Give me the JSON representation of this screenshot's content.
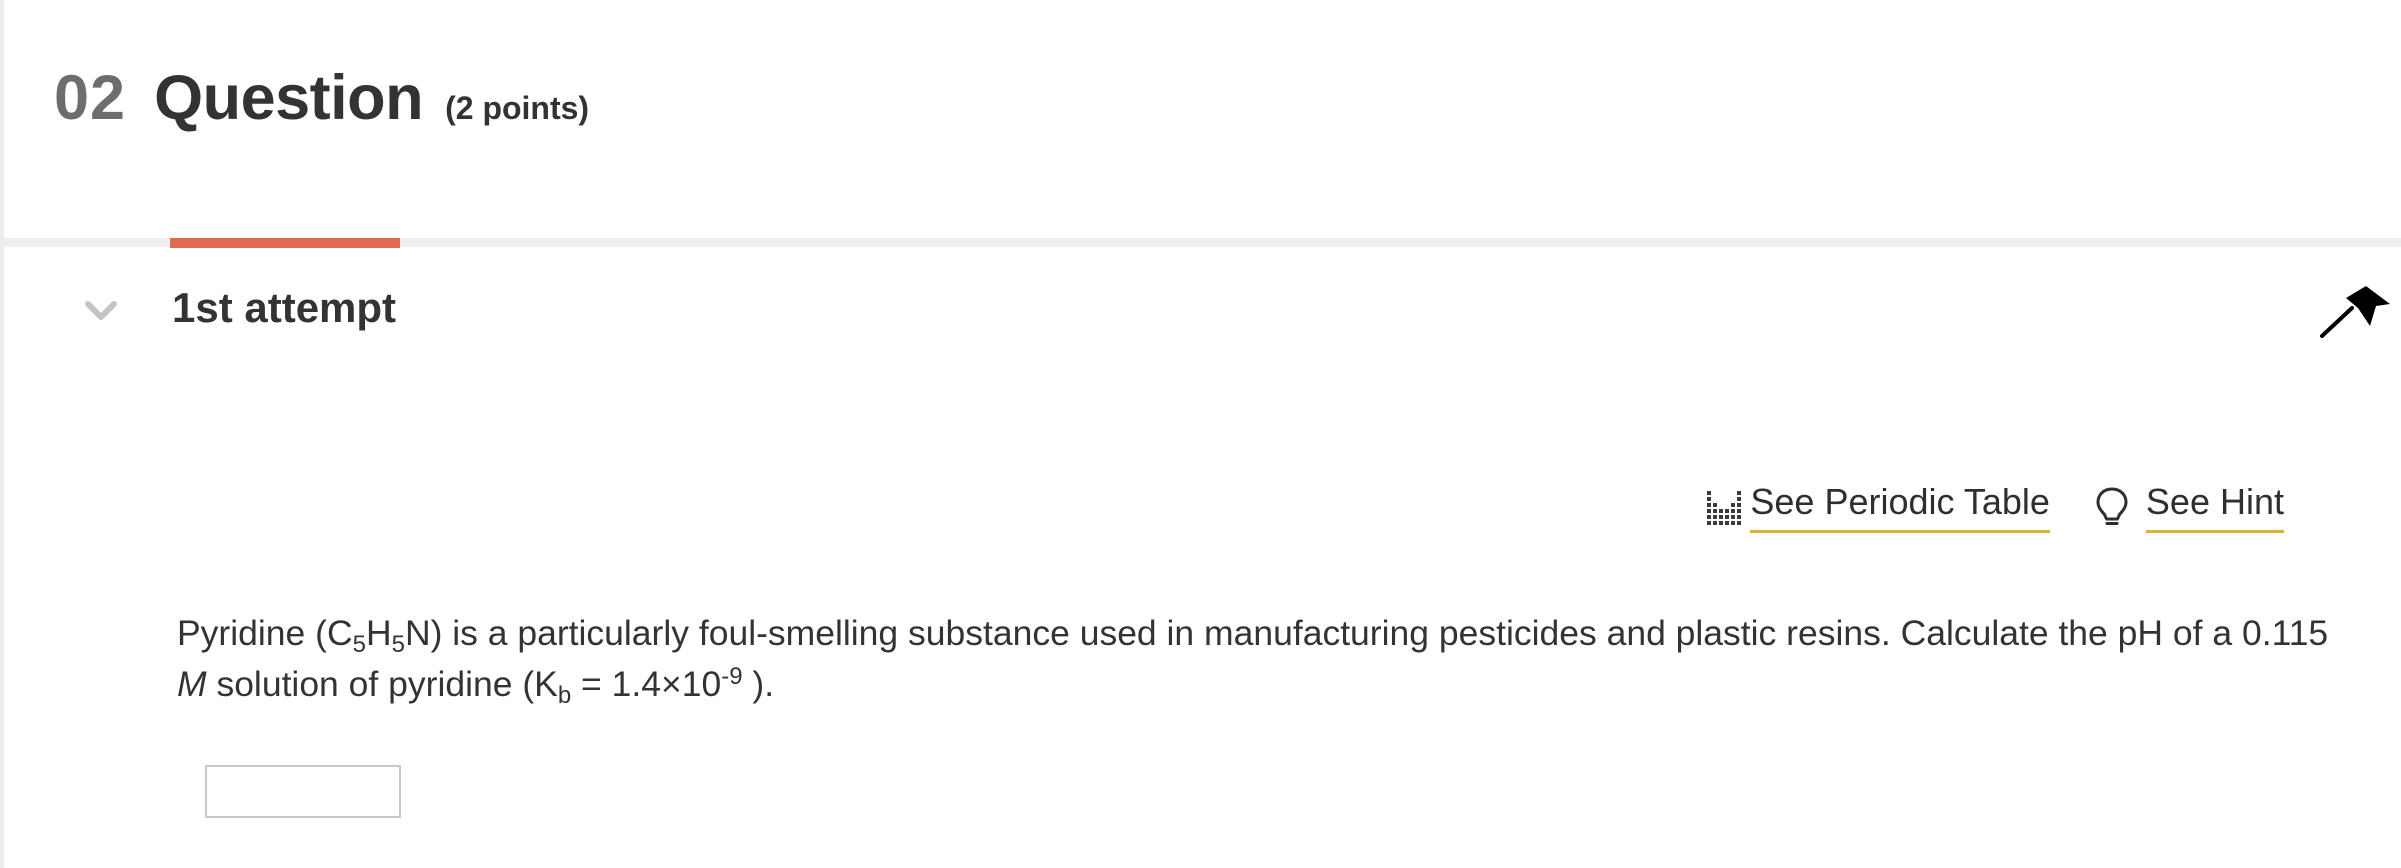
{
  "header": {
    "number": "02",
    "title": "Question",
    "points": "(2 points)"
  },
  "attempt": {
    "label": "1st attempt"
  },
  "links": {
    "periodic_table": "See Periodic Table",
    "hint": "See Hint"
  },
  "question": {
    "part1": "Pyridine (C",
    "sub1": "5",
    "part2": "H",
    "sub2": "5",
    "part3": "N) is a particularly foul-smelling substance used in manufacturing pesticides and plastic resins. Calculate the pH of a 0.115 ",
    "unit": "M",
    "part4": " solution of pyridine (K",
    "sub3": "b",
    "part5": " = 1.4×10",
    "sup1": "-9",
    "part6": " )."
  },
  "answer": {
    "value": ""
  },
  "colors": {
    "accent_tab": "#e06a4f",
    "link_underline": "#d9b534"
  },
  "icons": [
    "chevron-down-icon",
    "flag-icon",
    "periodic-table-icon",
    "lightbulb-icon"
  ]
}
